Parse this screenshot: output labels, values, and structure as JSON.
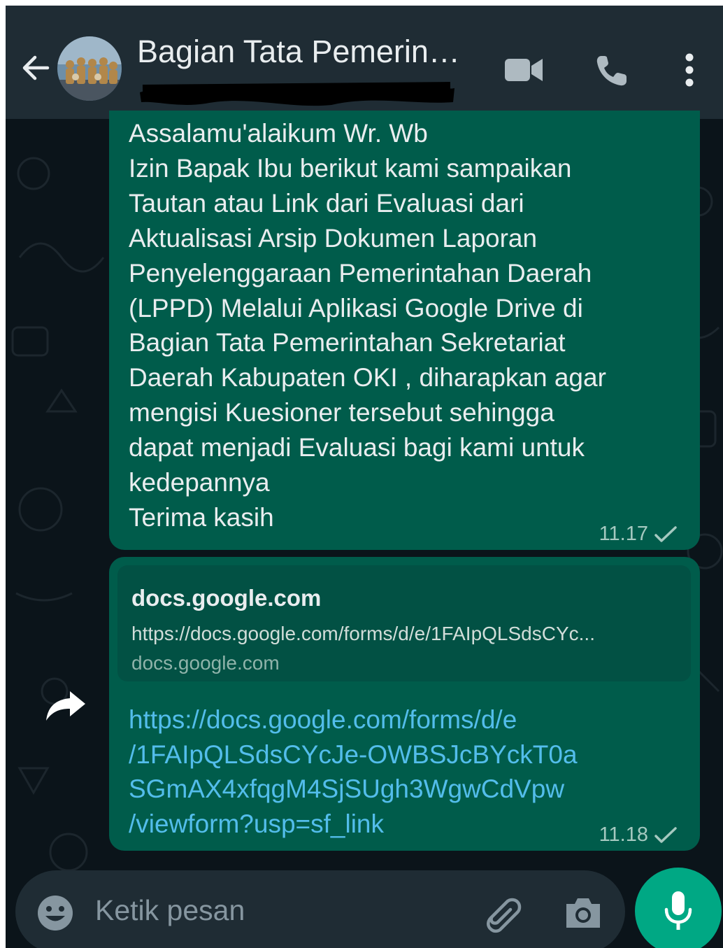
{
  "header": {
    "title": "Bagian Tata Pemerin…",
    "subtitle_redacted": true
  },
  "messages": [
    {
      "type": "text",
      "text": "Assalamu'alaikum Wr. Wb\nIzin Bapak Ibu berikut kami sampaikan\nTautan atau Link dari Evaluasi dari\nAktualisasi Arsip Dokumen Laporan\nPenyelenggaraan Pemerintahan Daerah\n(LPPD)  Melalui Aplikasi Google Drive di\nBagian Tata Pemerintahan Sekretariat\nDaerah Kabupaten OKI , diharapkan agar\nmengisi Kuesioner tersebut sehingga\ndapat menjadi Evaluasi bagi kami untuk\nkedepannya\nTerima kasih",
      "time": "11.17",
      "status": "sent"
    },
    {
      "type": "link",
      "preview_domain": "docs.google.com",
      "preview_url": "https://docs.google.com/forms/d/e/1FAIpQLSdsCYc...",
      "preview_site": "docs.google.com",
      "link_text": "https://docs.google.com/forms/d/e\n/1FAIpQLSdsCYcJe-OWBSJcBYckT0a\nSGmAX4xfqgM4SjSUgh3WgwCdVpw\n/viewform?usp=sf_link",
      "time": "11.18",
      "status": "sent"
    }
  ],
  "input": {
    "placeholder": "Ketik pesan"
  },
  "colors": {
    "background": "#0b141a",
    "header": "#1f2c34",
    "outgoing_bubble": "#005c4b",
    "link": "#53bdeb",
    "accent": "#00a884"
  },
  "icons": [
    "back-arrow-icon",
    "video-call-icon",
    "phone-icon",
    "more-vert-icon",
    "check-icon",
    "forward-icon",
    "emoji-icon",
    "attach-icon",
    "camera-icon",
    "mic-icon"
  ]
}
